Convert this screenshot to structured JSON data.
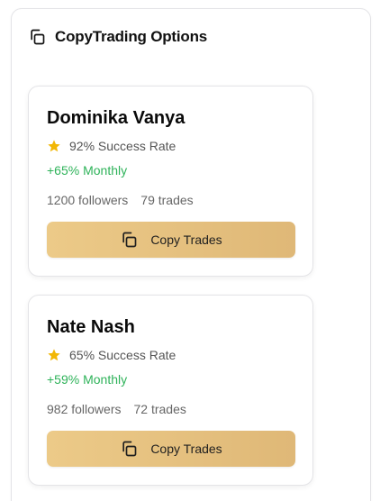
{
  "panel": {
    "title": "CopyTrading Options",
    "icon": "copy-icon"
  },
  "traders": [
    {
      "name": "Dominika Vanya",
      "success_rate": "92% Success Rate",
      "monthly": "+65% Monthly",
      "followers": "1200 followers",
      "trades": "79 trades",
      "button_label": "Copy Trades"
    },
    {
      "name": "Nate Nash",
      "success_rate": "65% Success Rate",
      "monthly": "+59% Monthly",
      "followers": "982 followers",
      "trades": "72 trades",
      "button_label": "Copy Trades"
    }
  ],
  "colors": {
    "accent_gold": "#e6c17f",
    "positive_green": "#2fb35a",
    "star_yellow": "#f2b705"
  }
}
